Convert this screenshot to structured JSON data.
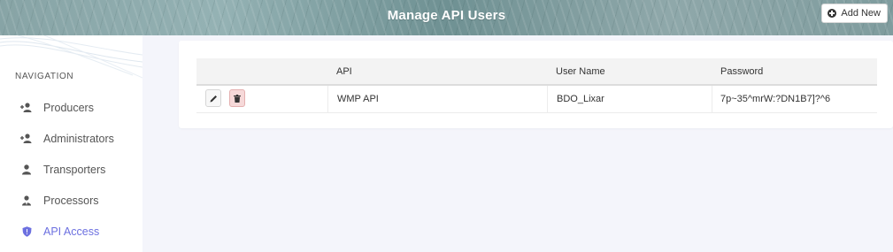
{
  "header": {
    "title": "Manage API Users",
    "add_new_label": "Add New"
  },
  "sidebar": {
    "heading": "NAVIGATION",
    "items": [
      {
        "label": "Producers",
        "icon": "user-plus-icon",
        "active": false
      },
      {
        "label": "Administrators",
        "icon": "user-plus-icon",
        "active": false
      },
      {
        "label": "Transporters",
        "icon": "user-icon",
        "active": false
      },
      {
        "label": "Processors",
        "icon": "user-tie-icon",
        "active": false
      },
      {
        "label": "API Access",
        "icon": "shield-icon",
        "active": true
      }
    ]
  },
  "table": {
    "columns": [
      "",
      "API",
      "User Name",
      "Password"
    ],
    "rows": [
      {
        "api": "WMP API",
        "user_name": "BDO_Lixar",
        "password": "7p~35^mrW:?DN1B7]?^6"
      }
    ]
  },
  "colors": {
    "accent": "#6c70e0",
    "delete_bg": "#f6d9d9"
  }
}
